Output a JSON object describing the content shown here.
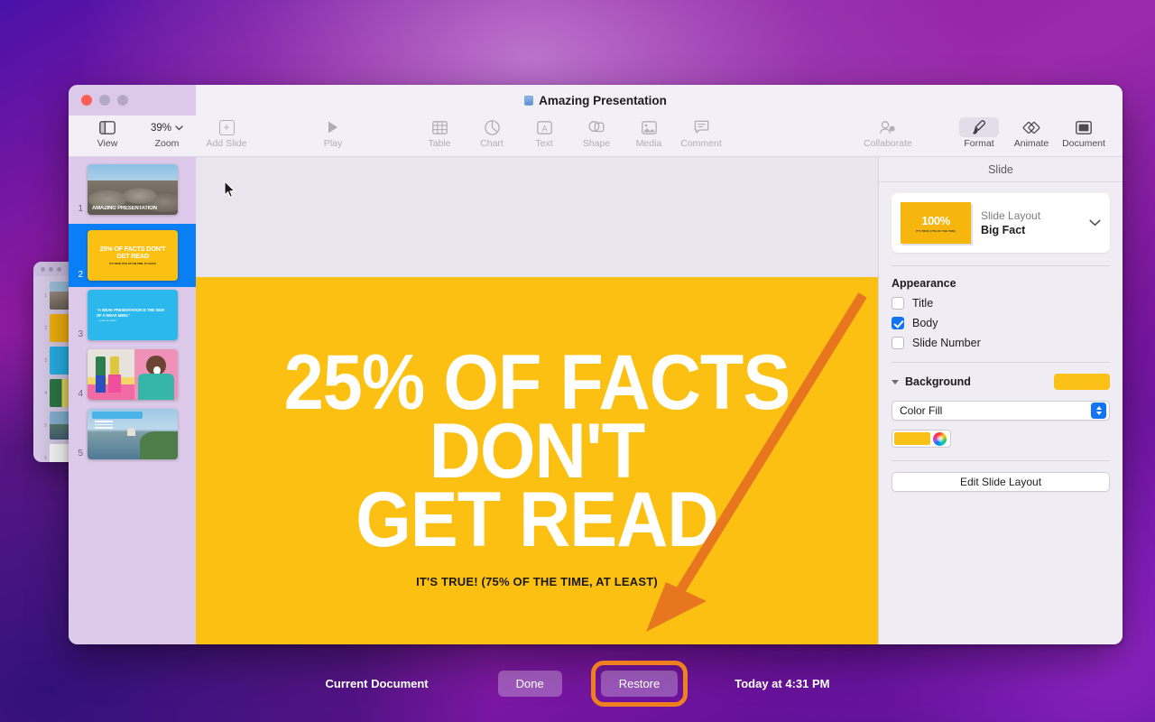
{
  "window": {
    "title": "Amazing Presentation",
    "doc_icon": "keynote-document-icon",
    "traffic_lights": [
      "close-red",
      "minimize-grey",
      "zoom-grey"
    ]
  },
  "toolbar": {
    "items": [
      {
        "label": "View",
        "icon": "sidebar-panel-icon",
        "enabled": true
      },
      {
        "label": "Zoom",
        "icon": "chevron-down-icon",
        "value": "39%",
        "enabled": true
      },
      {
        "label": "Add Slide",
        "icon": "plus-square-icon",
        "enabled": false
      },
      {
        "label": "Play",
        "icon": "play-triangle-icon",
        "enabled": false
      },
      {
        "label": "Table",
        "icon": "table-grid-icon",
        "enabled": false
      },
      {
        "label": "Chart",
        "icon": "pie-chart-icon",
        "enabled": false
      },
      {
        "label": "Text",
        "icon": "text-box-icon",
        "enabled": false
      },
      {
        "label": "Shape",
        "icon": "shapes-icon",
        "enabled": false
      },
      {
        "label": "Media",
        "icon": "photo-icon",
        "enabled": false
      },
      {
        "label": "Comment",
        "icon": "speech-bubble-icon",
        "enabled": false
      },
      {
        "label": "Collaborate",
        "icon": "person-add-icon",
        "enabled": false
      },
      {
        "label": "Format",
        "icon": "paintbrush-icon",
        "enabled": true,
        "selected": true
      },
      {
        "label": "Animate",
        "icon": "diamonds-icon",
        "enabled": true
      },
      {
        "label": "Document",
        "icon": "document-frame-icon",
        "enabled": true
      }
    ]
  },
  "navigator": {
    "slides": [
      {
        "number": "1",
        "kind": "photo-title",
        "caption": "AMAZING PRESENTATION",
        "selected": false
      },
      {
        "number": "2",
        "kind": "big-fact",
        "line1": "25% OF FACTS DON'T",
        "line2": "GET READ",
        "sub": "IT'S TRUE! (75% OF THE TIME, AT LEAST)",
        "selected": true
      },
      {
        "number": "3",
        "kind": "quote",
        "quote": "\"A WEAK PRESENTATION IS THE SIGN OF A WEAK MIND.\"",
        "source": "— SOMEONE SMART",
        "selected": false
      },
      {
        "number": "4",
        "kind": "photo-grid",
        "selected": false
      },
      {
        "number": "5",
        "kind": "photo-water",
        "selected": false
      }
    ]
  },
  "canvas": {
    "slide": {
      "line1": "25% OF FACTS DON'T",
      "line2": "GET READ",
      "subtitle": "IT'S TRUE! (75% OF THE TIME, AT LEAST)",
      "background_color": "#fcc013",
      "text_color": "#ffffff"
    },
    "annotation": {
      "type": "arrow",
      "color": "#e8761f",
      "points_to": "restore-button"
    }
  },
  "inspector": {
    "header": "Slide",
    "layout": {
      "label": "Slide Layout",
      "value": "Big Fact",
      "thumb_text": "100%",
      "thumb_sub": "IT'S TRUE! (75% OF THE TIME)",
      "chevron": "chevron-down-icon"
    },
    "appearance": {
      "title": "Appearance",
      "options": [
        {
          "label": "Title",
          "checked": false
        },
        {
          "label": "Body",
          "checked": true
        },
        {
          "label": "Slide Number",
          "checked": false
        }
      ]
    },
    "background": {
      "label": "Background",
      "swatch_color": "#fcc116",
      "fill_type": "Color Fill",
      "fill_color": "#fcc116"
    },
    "edit_layout_button": "Edit Slide Layout"
  },
  "version_bar": {
    "current_label": "Current Document",
    "done_button": "Done",
    "restore_button": "Restore",
    "date": "Today at 4:31 PM",
    "highlight_color": "#ef7f1f"
  },
  "background_window": {
    "slide_numbers": [
      "1",
      "2",
      "3",
      "4",
      "5",
      "6"
    ]
  }
}
